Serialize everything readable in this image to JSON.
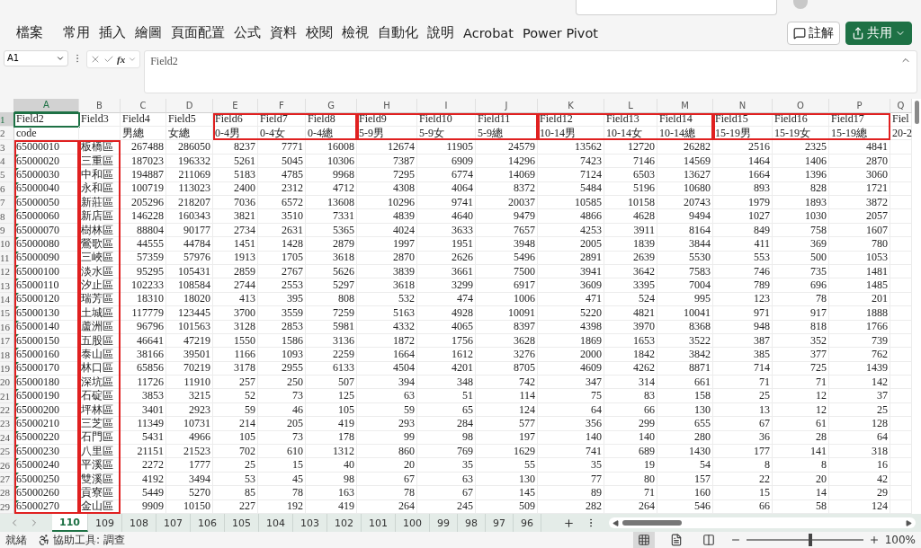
{
  "ribbon": {
    "tabs": [
      {
        "label": "檔案"
      },
      {
        "label": "常用"
      },
      {
        "label": "插入"
      },
      {
        "label": "繪圖"
      },
      {
        "label": "頁面配置"
      },
      {
        "label": "公式"
      },
      {
        "label": "資料"
      },
      {
        "label": "校閱"
      },
      {
        "label": "檢視"
      },
      {
        "label": "自動化"
      },
      {
        "label": "說明"
      },
      {
        "label": "Acrobat"
      },
      {
        "label": "Power Pivot"
      }
    ],
    "buttons": [
      {
        "kind": "comments",
        "label": "註解"
      },
      {
        "kind": "share",
        "label": "共用"
      }
    ]
  },
  "formula_bar": {
    "name_box": "A1",
    "fx": "fx",
    "value": "Field2"
  },
  "sheet": {
    "column_groups": [
      {
        "kind": "column_frame",
        "columns": [
          {
            "letter": "A",
            "selected": true
          }
        ]
      },
      {
        "kind": "column_frame",
        "columns": [
          {
            "letter": "B",
            "selected": false
          }
        ]
      },
      {
        "kind": "plain",
        "columns": [
          {
            "letter": "C",
            "selected": false
          },
          {
            "letter": "D",
            "selected": false
          }
        ]
      },
      {
        "kind": "header_frame",
        "columns": [
          {
            "letter": "E",
            "selected": false
          },
          {
            "letter": "F",
            "selected": false
          },
          {
            "letter": "G",
            "selected": false
          }
        ]
      },
      {
        "kind": "header_frame",
        "columns": [
          {
            "letter": "H",
            "selected": false
          },
          {
            "letter": "I",
            "selected": false
          },
          {
            "letter": "J",
            "selected": false
          }
        ]
      },
      {
        "kind": "header_frame",
        "columns": [
          {
            "letter": "K",
            "selected": false
          },
          {
            "letter": "L",
            "selected": false
          },
          {
            "letter": "M",
            "selected": false
          }
        ]
      },
      {
        "kind": "header_frame",
        "columns": [
          {
            "letter": "N",
            "selected": false
          },
          {
            "letter": "O",
            "selected": false
          },
          {
            "letter": "P",
            "selected": false
          }
        ]
      },
      {
        "kind": "plain",
        "columns": [
          {
            "letter": "Q",
            "selected": false
          }
        ]
      }
    ],
    "header_rows": [
      {
        "number": "1",
        "selected": true,
        "cells": [
          "Field2",
          "Field3",
          "Field4",
          "Field5",
          "Field6",
          "Field7",
          "Field8",
          "Field9",
          "Field10",
          "Field11",
          "Field12",
          "Field13",
          "Field14",
          "Field15",
          "Field16",
          "Field17",
          "Fiel"
        ]
      },
      {
        "number": "2",
        "selected": false,
        "cells": [
          "code",
          "",
          "男總",
          "女總",
          "0-4男",
          "0-4女",
          "0-4總",
          "5-9男",
          "5-9女",
          "5-9總",
          "10-14男",
          "10-14女",
          "10-14總",
          "15-19男",
          "15-19女",
          "15-19總",
          "20-2"
        ]
      }
    ],
    "rows": [
      {
        "number": "3",
        "selected": false,
        "flag": false,
        "code": "65000010",
        "district": "板橋區",
        "values": [
          "267488",
          "286050",
          "8237",
          "7771",
          "16008",
          "12674",
          "11905",
          "24579",
          "13562",
          "12720",
          "26282",
          "2516",
          "2325",
          "4841"
        ]
      },
      {
        "number": "4",
        "selected": false,
        "flag": true,
        "code": "65000020",
        "district": "三重區",
        "values": [
          "187023",
          "196332",
          "5261",
          "5045",
          "10306",
          "7387",
          "6909",
          "14296",
          "7423",
          "7146",
          "14569",
          "1464",
          "1406",
          "2870"
        ]
      },
      {
        "number": "5",
        "selected": false,
        "flag": true,
        "code": "65000030",
        "district": "中和區",
        "values": [
          "194887",
          "211069",
          "5183",
          "4785",
          "9968",
          "7295",
          "6774",
          "14069",
          "7124",
          "6503",
          "13627",
          "1664",
          "1396",
          "3060"
        ]
      },
      {
        "number": "6",
        "selected": false,
        "flag": true,
        "code": "65000040",
        "district": "永和區",
        "values": [
          "100719",
          "113023",
          "2400",
          "2312",
          "4712",
          "4308",
          "4064",
          "8372",
          "5484",
          "5196",
          "10680",
          "893",
          "828",
          "1721"
        ]
      },
      {
        "number": "7",
        "selected": false,
        "flag": true,
        "code": "65000050",
        "district": "新莊區",
        "values": [
          "205296",
          "218207",
          "7036",
          "6572",
          "13608",
          "10296",
          "9741",
          "20037",
          "10585",
          "10158",
          "20743",
          "1979",
          "1893",
          "3872"
        ]
      },
      {
        "number": "8",
        "selected": false,
        "flag": true,
        "code": "65000060",
        "district": "新店區",
        "values": [
          "146228",
          "160343",
          "3821",
          "3510",
          "7331",
          "4839",
          "4640",
          "9479",
          "4866",
          "4628",
          "9494",
          "1027",
          "1030",
          "2057"
        ]
      },
      {
        "number": "9",
        "selected": false,
        "flag": true,
        "code": "65000070",
        "district": "樹林區",
        "values": [
          "88804",
          "90177",
          "2734",
          "2631",
          "5365",
          "4024",
          "3633",
          "7657",
          "4253",
          "3911",
          "8164",
          "849",
          "758",
          "1607"
        ]
      },
      {
        "number": "10",
        "selected": false,
        "flag": true,
        "code": "65000080",
        "district": "鶯歌區",
        "values": [
          "44555",
          "44784",
          "1451",
          "1428",
          "2879",
          "1997",
          "1951",
          "3948",
          "2005",
          "1839",
          "3844",
          "411",
          "369",
          "780"
        ]
      },
      {
        "number": "11",
        "selected": false,
        "flag": true,
        "code": "65000090",
        "district": "三峽區",
        "values": [
          "57359",
          "57976",
          "1913",
          "1705",
          "3618",
          "2870",
          "2626",
          "5496",
          "2891",
          "2639",
          "5530",
          "553",
          "500",
          "1053"
        ]
      },
      {
        "number": "12",
        "selected": false,
        "flag": true,
        "code": "65000100",
        "district": "淡水區",
        "values": [
          "95295",
          "105431",
          "2859",
          "2767",
          "5626",
          "3839",
          "3661",
          "7500",
          "3941",
          "3642",
          "7583",
          "746",
          "735",
          "1481"
        ]
      },
      {
        "number": "13",
        "selected": false,
        "flag": true,
        "code": "65000110",
        "district": "汐止區",
        "values": [
          "102233",
          "108584",
          "2744",
          "2553",
          "5297",
          "3618",
          "3299",
          "6917",
          "3609",
          "3395",
          "7004",
          "789",
          "696",
          "1485"
        ]
      },
      {
        "number": "14",
        "selected": false,
        "flag": true,
        "code": "65000120",
        "district": "瑞芳區",
        "values": [
          "18310",
          "18020",
          "413",
          "395",
          "808",
          "532",
          "474",
          "1006",
          "471",
          "524",
          "995",
          "123",
          "78",
          "201"
        ]
      },
      {
        "number": "15",
        "selected": false,
        "flag": true,
        "code": "65000130",
        "district": "土城區",
        "values": [
          "117779",
          "123445",
          "3700",
          "3559",
          "7259",
          "5163",
          "4928",
          "10091",
          "5220",
          "4821",
          "10041",
          "971",
          "917",
          "1888"
        ]
      },
      {
        "number": "16",
        "selected": false,
        "flag": true,
        "code": "65000140",
        "district": "蘆洲區",
        "values": [
          "96796",
          "101563",
          "3128",
          "2853",
          "5981",
          "4332",
          "4065",
          "8397",
          "4398",
          "3970",
          "8368",
          "948",
          "818",
          "1766"
        ]
      },
      {
        "number": "17",
        "selected": false,
        "flag": true,
        "code": "65000150",
        "district": "五股區",
        "values": [
          "46641",
          "47219",
          "1550",
          "1586",
          "3136",
          "1872",
          "1756",
          "3628",
          "1869",
          "1653",
          "3522",
          "387",
          "352",
          "739"
        ]
      },
      {
        "number": "18",
        "selected": false,
        "flag": true,
        "code": "65000160",
        "district": "泰山區",
        "values": [
          "38166",
          "39501",
          "1166",
          "1093",
          "2259",
          "1664",
          "1612",
          "3276",
          "2000",
          "1842",
          "3842",
          "385",
          "377",
          "762"
        ]
      },
      {
        "number": "19",
        "selected": false,
        "flag": true,
        "code": "65000170",
        "district": "林口區",
        "values": [
          "65856",
          "70219",
          "3178",
          "2955",
          "6133",
          "4504",
          "4201",
          "8705",
          "4609",
          "4262",
          "8871",
          "714",
          "725",
          "1439"
        ]
      },
      {
        "number": "20",
        "selected": false,
        "flag": true,
        "code": "65000180",
        "district": "深坑區",
        "values": [
          "11726",
          "11910",
          "257",
          "250",
          "507",
          "394",
          "348",
          "742",
          "347",
          "314",
          "661",
          "71",
          "71",
          "142"
        ]
      },
      {
        "number": "21",
        "selected": false,
        "flag": true,
        "code": "65000190",
        "district": "石碇區",
        "values": [
          "3853",
          "3215",
          "52",
          "73",
          "125",
          "63",
          "51",
          "114",
          "75",
          "83",
          "158",
          "25",
          "12",
          "37"
        ]
      },
      {
        "number": "22",
        "selected": false,
        "flag": true,
        "code": "65000200",
        "district": "坪林區",
        "values": [
          "3401",
          "2923",
          "59",
          "46",
          "105",
          "59",
          "65",
          "124",
          "64",
          "66",
          "130",
          "13",
          "12",
          "25"
        ]
      },
      {
        "number": "23",
        "selected": false,
        "flag": true,
        "code": "65000210",
        "district": "三芝區",
        "values": [
          "11349",
          "10731",
          "214",
          "205",
          "419",
          "293",
          "284",
          "577",
          "356",
          "299",
          "655",
          "67",
          "61",
          "128"
        ]
      },
      {
        "number": "24",
        "selected": false,
        "flag": true,
        "code": "65000220",
        "district": "石門區",
        "values": [
          "5431",
          "4966",
          "105",
          "73",
          "178",
          "99",
          "98",
          "197",
          "140",
          "140",
          "280",
          "36",
          "28",
          "64"
        ]
      },
      {
        "number": "25",
        "selected": false,
        "flag": true,
        "code": "65000230",
        "district": "八里區",
        "values": [
          "21151",
          "21523",
          "702",
          "610",
          "1312",
          "860",
          "769",
          "1629",
          "741",
          "689",
          "1430",
          "177",
          "141",
          "318"
        ]
      },
      {
        "number": "26",
        "selected": false,
        "flag": true,
        "code": "65000240",
        "district": "平溪區",
        "values": [
          "2272",
          "1777",
          "25",
          "15",
          "40",
          "20",
          "35",
          "55",
          "35",
          "19",
          "54",
          "8",
          "8",
          "16"
        ]
      },
      {
        "number": "27",
        "selected": false,
        "flag": true,
        "code": "65000250",
        "district": "雙溪區",
        "values": [
          "4192",
          "3494",
          "53",
          "45",
          "98",
          "67",
          "63",
          "130",
          "77",
          "80",
          "157",
          "22",
          "20",
          "42"
        ]
      },
      {
        "number": "28",
        "selected": false,
        "flag": true,
        "code": "65000260",
        "district": "貢寮區",
        "values": [
          "5449",
          "5270",
          "85",
          "78",
          "163",
          "78",
          "67",
          "145",
          "89",
          "71",
          "160",
          "15",
          "14",
          "29"
        ]
      },
      {
        "number": "29",
        "selected": false,
        "flag": true,
        "code": "65000270",
        "district": "金山區",
        "values": [
          "9909",
          "10150",
          "227",
          "192",
          "419",
          "264",
          "245",
          "509",
          "282",
          "264",
          "546",
          "66",
          "58",
          "124"
        ]
      }
    ]
  },
  "sheet_tabs": [
    {
      "label": "110",
      "selected": true
    },
    {
      "label": "109",
      "selected": false
    },
    {
      "label": "108",
      "selected": false
    },
    {
      "label": "107",
      "selected": false
    },
    {
      "label": "106",
      "selected": false
    },
    {
      "label": "105",
      "selected": false
    },
    {
      "label": "104",
      "selected": false
    },
    {
      "label": "103",
      "selected": false
    },
    {
      "label": "102",
      "selected": false
    },
    {
      "label": "101",
      "selected": false
    },
    {
      "label": "100",
      "selected": false
    },
    {
      "label": "99",
      "selected": false
    },
    {
      "label": "98",
      "selected": false
    },
    {
      "label": "97",
      "selected": false
    },
    {
      "label": "96",
      "selected": false
    }
  ],
  "status_bar": {
    "state": "就緒",
    "accessibility": "協助工具: 調查",
    "views": [
      {
        "kind": "normal",
        "selected": true
      },
      {
        "kind": "page",
        "selected": false
      },
      {
        "kind": "break",
        "selected": false
      }
    ],
    "zoom": {
      "level": 0.55,
      "reading": "100%"
    }
  }
}
